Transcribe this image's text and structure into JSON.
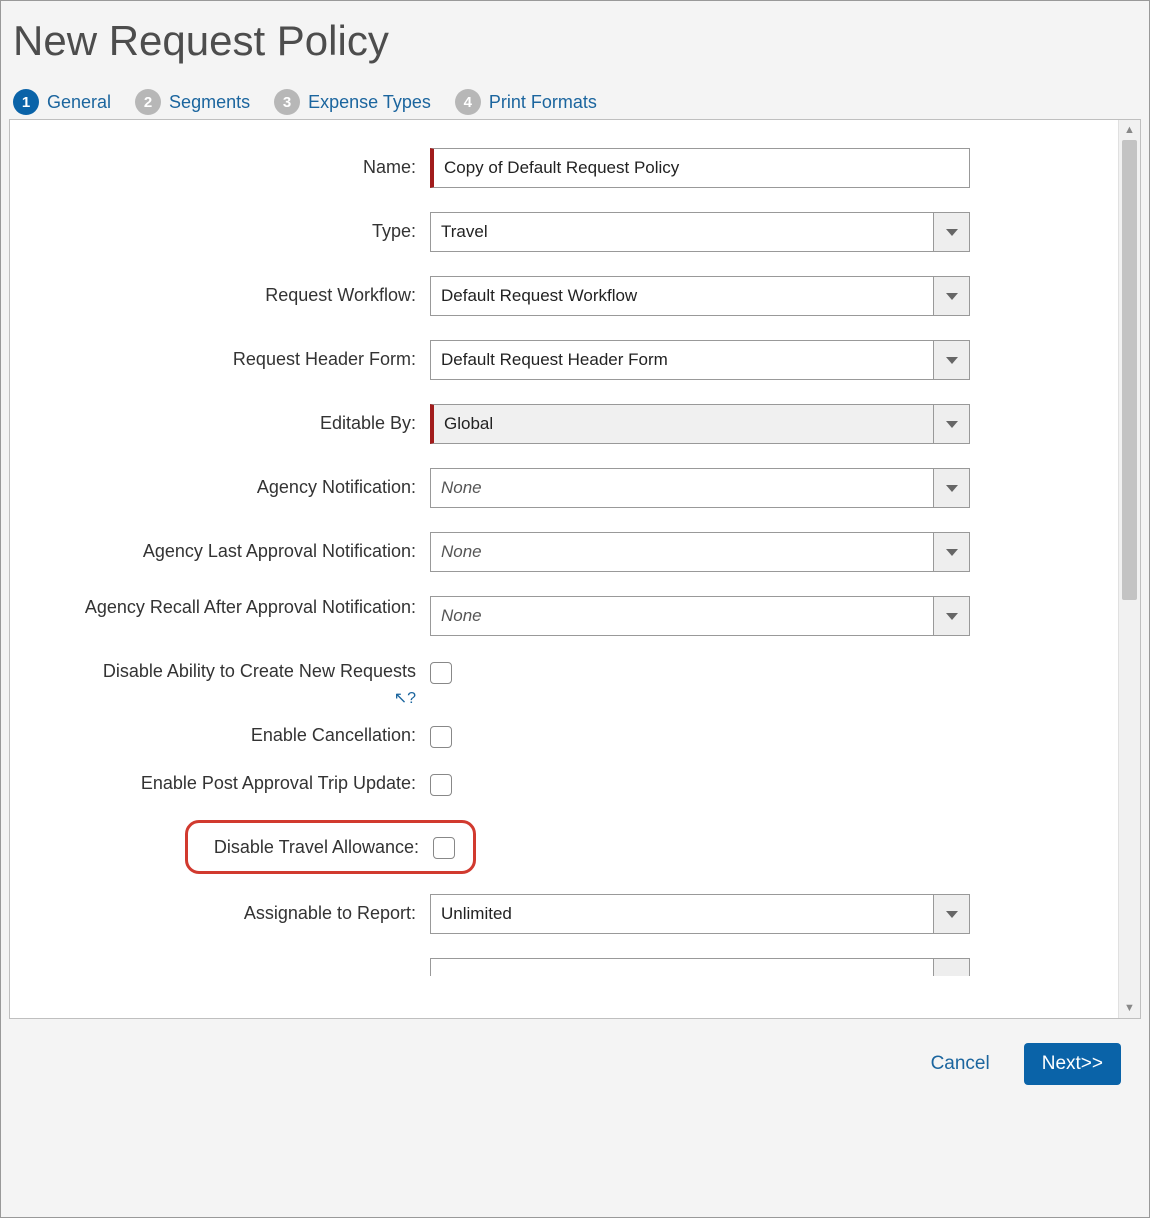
{
  "title": "New Request Policy",
  "steps": [
    {
      "num": "1",
      "label": "General",
      "active": true
    },
    {
      "num": "2",
      "label": "Segments",
      "active": false
    },
    {
      "num": "3",
      "label": "Expense Types",
      "active": false
    },
    {
      "num": "4",
      "label": "Print Formats",
      "active": false
    }
  ],
  "form": {
    "name": {
      "label": "Name:",
      "value": "Copy of Default Request Policy"
    },
    "type": {
      "label": "Type:",
      "value": "Travel"
    },
    "workflow": {
      "label": "Request Workflow:",
      "value": "Default Request Workflow"
    },
    "headerForm": {
      "label": "Request Header Form:",
      "value": "Default Request Header Form"
    },
    "editableBy": {
      "label": "Editable By:",
      "value": "Global"
    },
    "agencyNotif": {
      "label": "Agency Notification:",
      "value": "None"
    },
    "agencyLast": {
      "label": "Agency Last Approval Notification:",
      "value": "None"
    },
    "agencyRecall": {
      "label": "Agency Recall After Approval Notification:",
      "value": "None"
    },
    "disableCreate": {
      "label": "Disable Ability to Create New Requests"
    },
    "enableCancel": {
      "label": "Enable Cancellation:"
    },
    "enablePost": {
      "label": "Enable Post Approval Trip Update:"
    },
    "disableTA": {
      "label": "Disable Travel Allowance:"
    },
    "assignable": {
      "label": "Assignable to Report:",
      "value": "Unlimited"
    }
  },
  "helpGlyph": "↖?",
  "buttons": {
    "cancel": "Cancel",
    "next": "Next>>"
  }
}
